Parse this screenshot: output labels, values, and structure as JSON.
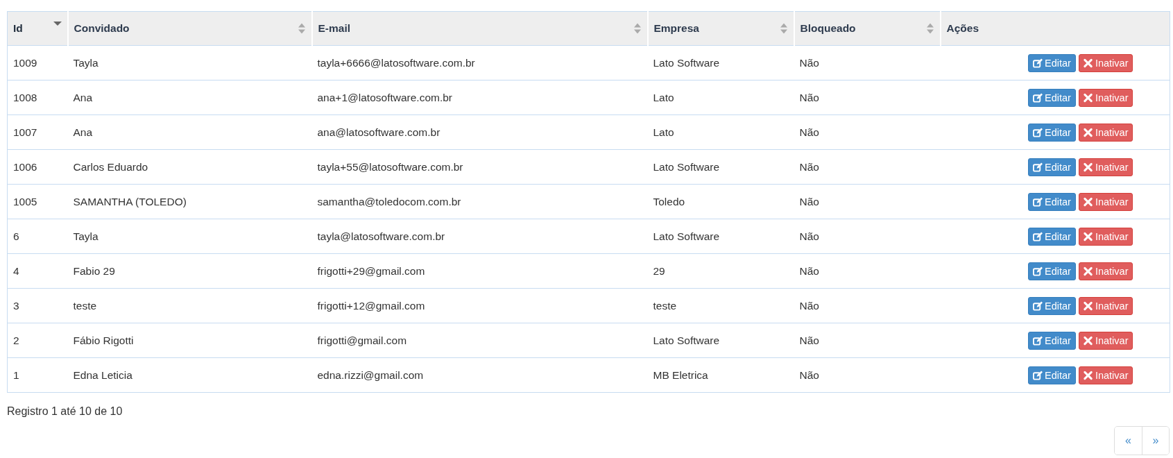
{
  "table": {
    "columns": [
      {
        "label": "Id",
        "sortable": true,
        "sorted": true
      },
      {
        "label": "Convidado",
        "sortable": true,
        "sorted": false
      },
      {
        "label": "E-mail",
        "sortable": true,
        "sorted": false
      },
      {
        "label": "Empresa",
        "sortable": true,
        "sorted": false
      },
      {
        "label": "Bloqueado",
        "sortable": true,
        "sorted": false
      },
      {
        "label": "Ações",
        "sortable": false,
        "sorted": false
      }
    ],
    "rows": [
      {
        "cells": [
          "1009",
          "Tayla",
          "tayla+6666@latosoftware.com.br",
          "Lato Software",
          "Não"
        ],
        "actions": [
          {
            "kind": "edit",
            "label": "Editar"
          },
          {
            "kind": "deactivate",
            "label": "Inativar"
          }
        ]
      },
      {
        "cells": [
          "1008",
          "Ana",
          "ana+1@latosoftware.com.br",
          "Lato",
          "Não"
        ],
        "actions": [
          {
            "kind": "edit",
            "label": "Editar"
          },
          {
            "kind": "deactivate",
            "label": "Inativar"
          }
        ]
      },
      {
        "cells": [
          "1007",
          "Ana",
          "ana@latosoftware.com.br",
          "Lato",
          "Não"
        ],
        "actions": [
          {
            "kind": "edit",
            "label": "Editar"
          },
          {
            "kind": "deactivate",
            "label": "Inativar"
          }
        ]
      },
      {
        "cells": [
          "1006",
          "Carlos Eduardo",
          "tayla+55@latosoftware.com.br",
          "Lato Software",
          "Não"
        ],
        "actions": [
          {
            "kind": "edit",
            "label": "Editar"
          },
          {
            "kind": "deactivate",
            "label": "Inativar"
          }
        ]
      },
      {
        "cells": [
          "1005",
          "SAMANTHA (TOLEDO)",
          "samantha@toledocom.com.br",
          "Toledo",
          "Não"
        ],
        "actions": [
          {
            "kind": "edit",
            "label": "Editar"
          },
          {
            "kind": "deactivate",
            "label": "Inativar"
          }
        ]
      },
      {
        "cells": [
          "6",
          "Tayla",
          "tayla@latosoftware.com.br",
          "Lato Software",
          "Não"
        ],
        "actions": [
          {
            "kind": "edit",
            "label": "Editar"
          },
          {
            "kind": "deactivate",
            "label": "Inativar"
          }
        ]
      },
      {
        "cells": [
          "4",
          "Fabio 29",
          "frigotti+29@gmail.com",
          "29",
          "Não"
        ],
        "actions": [
          {
            "kind": "edit",
            "label": "Editar"
          },
          {
            "kind": "deactivate",
            "label": "Inativar"
          }
        ]
      },
      {
        "cells": [
          "3",
          "teste",
          "frigotti+12@gmail.com",
          "teste",
          "Não"
        ],
        "actions": [
          {
            "kind": "edit",
            "label": "Editar"
          },
          {
            "kind": "deactivate",
            "label": "Inativar"
          }
        ]
      },
      {
        "cells": [
          "2",
          "Fábio Rigotti",
          "frigotti@gmail.com",
          "Lato Software",
          "Não"
        ],
        "actions": [
          {
            "kind": "edit",
            "label": "Editar"
          },
          {
            "kind": "deactivate",
            "label": "Inativar"
          }
        ]
      },
      {
        "cells": [
          "1",
          "Edna Leticia",
          "edna.rizzi@gmail.com",
          "MB Eletrica",
          "Não"
        ],
        "actions": [
          {
            "kind": "edit",
            "label": "Editar"
          },
          {
            "kind": "deactivate",
            "label": "Inativar"
          }
        ]
      }
    ]
  },
  "info": "Registro 1 até 10 de 10",
  "pagination": [
    "«",
    "»"
  ]
}
